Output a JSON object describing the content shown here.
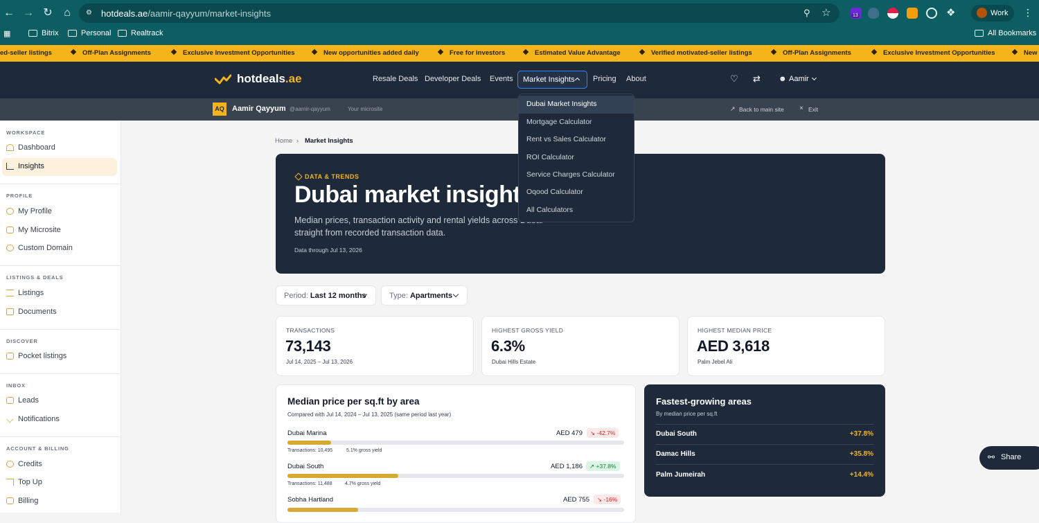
{
  "browser": {
    "url_host": "hotdeals.ae",
    "url_path": "/aamir-qayyum/market-insights",
    "extension_badge": "13",
    "profile_label": "Work",
    "bookmarks": [
      "Bitrix",
      "Personal",
      "Realtrack"
    ],
    "all_bookmarks": "All Bookmarks"
  },
  "ticker": [
    "ed-seller listings",
    "Off-Plan Assignments",
    "Exclusive Investment Opportunities",
    "New opportunities added daily",
    "Free for investors",
    "Estimated Value Advantage",
    "Verified motivated-seller listings",
    "Off-Plan Assignments",
    "Exclusive Investment Opportunities",
    "New"
  ],
  "header": {
    "logo_main": "hotdeals",
    "logo_suffix": ".ae",
    "nav": [
      "Resale Deals",
      "Developer Deals",
      "Events",
      "Market Insights",
      "Pricing",
      "About"
    ],
    "user": "Aamir"
  },
  "subheader": {
    "initials": "AQ",
    "name": "Aamir Qayyum",
    "handle": "@aamir-qayyum",
    "microsite": "Your microsite",
    "back": "Back to main site",
    "exit": "Exit"
  },
  "sidebar": {
    "sections": [
      {
        "title": "WORKSPACE",
        "items": [
          "Dashboard",
          "Insights"
        ]
      },
      {
        "title": "PROFILE",
        "items": [
          "My Profile",
          "My Microsite",
          "Custom Domain"
        ]
      },
      {
        "title": "LISTINGS & DEALS",
        "items": [
          "Listings",
          "Documents"
        ]
      },
      {
        "title": "DISCOVER",
        "items": [
          "Pocket listings"
        ]
      },
      {
        "title": "INBOX",
        "items": [
          "Leads",
          "Notifications"
        ]
      },
      {
        "title": "ACCOUNT & BILLING",
        "items": [
          "Credits",
          "Top Up",
          "Billing"
        ]
      }
    ]
  },
  "breadcrumb": {
    "home": "Home",
    "current": "Market Insights"
  },
  "hero": {
    "tag": "DATA & TRENDS",
    "title": "Dubai market insights",
    "subtitle_line1": "Median prices, transaction activity and rental yields across Dubai",
    "subtitle_line2": "straight from recorded transaction data.",
    "date": "Data through Jul 13, 2026"
  },
  "filters": {
    "period_label": "Period:",
    "period_value": "Last 12 months",
    "type_label": "Type:",
    "type_value": "Apartments"
  },
  "stats": [
    {
      "label": "TRANSACTIONS",
      "value": "73,143",
      "sub": "Jul 14, 2025 – Jul 13, 2026"
    },
    {
      "label": "HIGHEST GROSS YIELD",
      "value": "6.3%",
      "sub": "Dubai Hills Estate"
    },
    {
      "label": "HIGHEST MEDIAN PRICE",
      "value": "AED 3,618",
      "sub": "Palm Jebel Ali"
    }
  ],
  "price_card": {
    "title": "Median price per sq.ft by area",
    "subtitle": "Compared with Jul 14, 2024 – Jul 13, 2025 (same period last year)",
    "rows": [
      {
        "area": "Dubai Marina",
        "price": "AED 479",
        "change": "-42.7%",
        "dir": "neg",
        "fill": 0.13,
        "transactions": "Transactions: 10,495",
        "yield": "5.1% gross yield"
      },
      {
        "area": "Dubai South",
        "price": "AED 1,186",
        "change": "+37.8%",
        "dir": "pos",
        "fill": 0.33,
        "transactions": "Transactions: 11,488",
        "yield": "4.7% gross yield"
      },
      {
        "area": "Sobha Hartland",
        "price": "AED 755",
        "change": "-16%",
        "dir": "neg",
        "fill": 0.21
      }
    ]
  },
  "growth_card": {
    "title": "Fastest-growing areas",
    "subtitle": "By median price per sq.ft",
    "rows": [
      {
        "area": "Dubai South",
        "value": "+37.8%"
      },
      {
        "area": "Damac Hills",
        "value": "+35.8%"
      },
      {
        "area": "Palm Jumeirah",
        "value": "+14.4%"
      }
    ]
  },
  "dropdown": [
    "Dubai Market Insights",
    "Mortgage Calculator",
    "Rent vs Sales Calculator",
    "ROI Calculator",
    "Service Charges Calculator",
    "Oqood Calculator",
    "All Calculators"
  ],
  "share_label": "Share",
  "colors": {
    "accent": "#f4b41a",
    "navy": "#1e2a3a",
    "chrome": "#0d5e63"
  }
}
